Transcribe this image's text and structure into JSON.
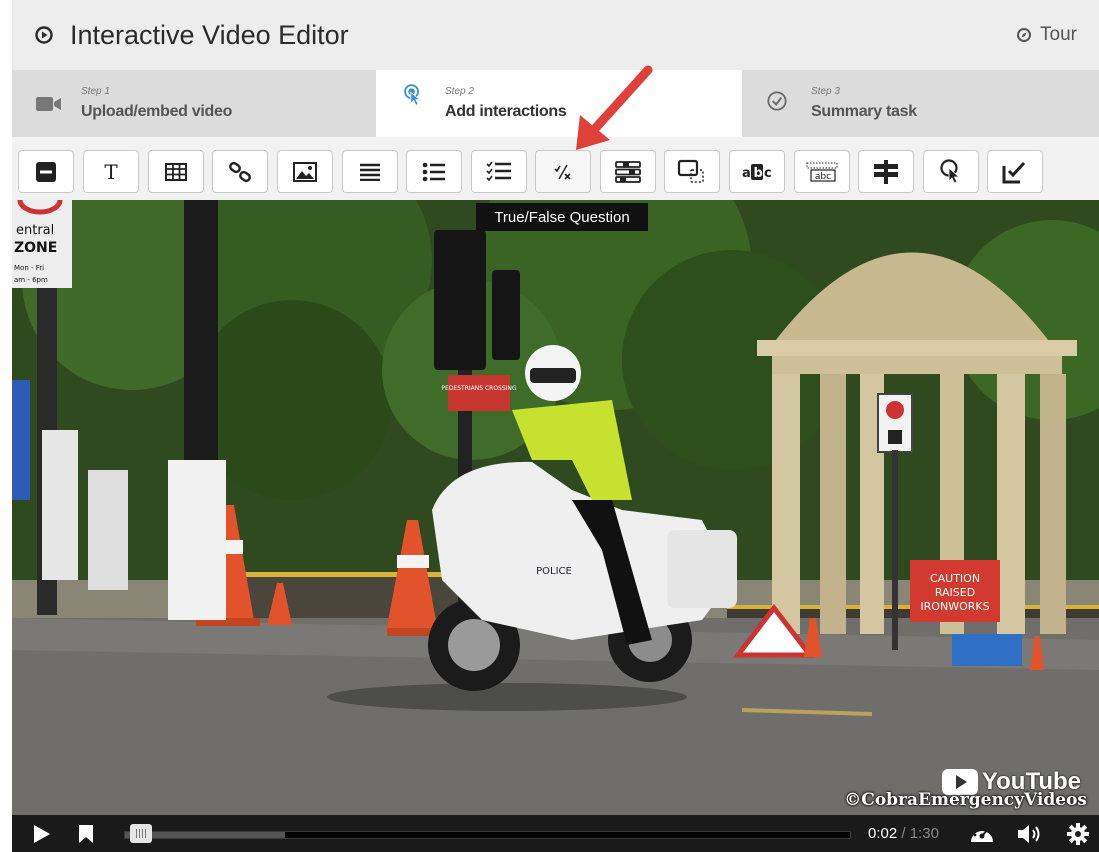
{
  "header": {
    "title": "Interactive Video Editor",
    "tour_label": "Tour"
  },
  "steps": [
    {
      "num": "Step 1",
      "label": "Upload/embed video"
    },
    {
      "num": "Step 2",
      "label": "Add interactions"
    },
    {
      "num": "Step 3",
      "label": "Summary task"
    }
  ],
  "toolbar": {
    "tools": [
      "label",
      "text",
      "table",
      "link",
      "image",
      "statements",
      "single-choice-set",
      "multiple-choice",
      "true-false",
      "fill-in-the-blanks",
      "drag-and-drop",
      "mark-the-words",
      "drag-text",
      "crossroads",
      "navigation-hotspot",
      "free-text-question"
    ],
    "active_tool": "true-false"
  },
  "tooltip": {
    "text": "True/False Question"
  },
  "video": {
    "signs": {
      "zone_line1": "entral",
      "zone_line2": "ZONE",
      "zone_line3": "Mon - Fri",
      "zone_line4": "am - 6pm",
      "pedestrian": "PEDESTRIANS CROSSING",
      "caution_l1": "CAUTION",
      "caution_l2": "RAISED",
      "caution_l3": "IRONWORKS",
      "police": "POLICE"
    },
    "youtube_label": "YouTube",
    "watermark": "©CobraEmergencyVideos"
  },
  "player": {
    "current_time": "0:02",
    "separator": "/",
    "total_time": "1:30",
    "progress": 0.022,
    "buffered": 0.22
  },
  "colors": {
    "arrow": "#e0403a",
    "step_active_icon": "#3b8fd6",
    "controls_bg": "#1a1a1a"
  }
}
